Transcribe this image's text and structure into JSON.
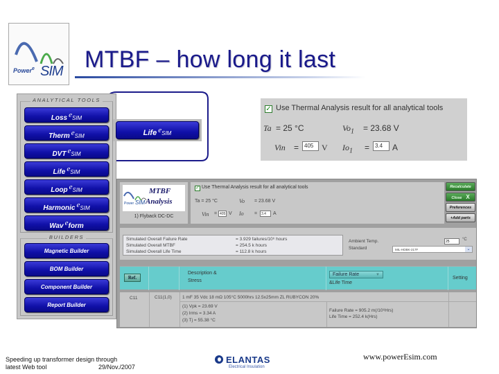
{
  "slide": {
    "title": "MTBF – how long it last",
    "logo": {
      "brand_prefix": "Power",
      "brand_e": "e",
      "brand_suffix": "SIM"
    }
  },
  "tool_panel": {
    "analytical_title": "ANALYTICAL TOOLS",
    "analytical_tools": [
      {
        "label": "Loss",
        "e": "e",
        "suffix": "SIM"
      },
      {
        "label": "Therm",
        "e": "e",
        "suffix": "SIM"
      },
      {
        "label": "DVT",
        "e": "e",
        "suffix": "SIM"
      },
      {
        "label": "Life",
        "e": "e",
        "suffix": "SIM"
      },
      {
        "label": "Loop",
        "e": "e",
        "suffix": "SIM"
      },
      {
        "label": "Harmonic",
        "e": "e",
        "suffix": "SIM"
      },
      {
        "label": "Wav",
        "e": "e",
        "suffix": "form"
      }
    ],
    "builders_title": "BUILDERS",
    "builders": [
      {
        "label": "Magnetic Builder"
      },
      {
        "label": "BOM Builder"
      },
      {
        "label": "Component Builder"
      },
      {
        "label": "Report Builder"
      }
    ]
  },
  "callout": {
    "label": "Life",
    "e": "e",
    "suffix": "SIM"
  },
  "thermal_zoom": {
    "checkbox_checked": true,
    "checkbox_label": "Use Thermal Analysis result for all analytical tools",
    "ta_label": "Ta",
    "ta_value": "= 25 °C",
    "vo_label": "Vo",
    "vo_sub": "1",
    "vo_value": "=   23.68 V",
    "vin_label": "Vin",
    "vin_eq": "=",
    "vin_value": "405",
    "vin_unit": "V",
    "io_label": "Io",
    "io_sub": "1",
    "io_eq": "=",
    "io_value": "3.4",
    "io_unit": "A"
  },
  "app": {
    "logo_title1": "MTBF",
    "logo_title2": "Analysis",
    "logo_power": "Power",
    "logo_sim": "SIM",
    "design_name": "1) Flyback DC-DC",
    "checkbox_label": "Use Thermal Analysis result for all analytical tools",
    "ta": "Ta = 25 °C",
    "vo_label": "Vo",
    "vo_value": "=   23.68 V",
    "vin_label": "Vin",
    "vin_eq": "=",
    "vin_value": "405",
    "vin_unit": "V",
    "io_label": "Io",
    "io_eq": "=",
    "io_value": "3.4",
    "io_unit": "A",
    "buttons": {
      "recalculate": "Recalculate",
      "close": "Close",
      "close_icon": "X",
      "preferences": "Preferences",
      "add_parts": "+Add parts"
    },
    "summary": [
      {
        "label": "Simulated Overall Failure Rate",
        "value": "= 3.929 failures/10⁶ hours"
      },
      {
        "label": "Simulated Overall MTBF",
        "value": "= 254.5 k hours"
      },
      {
        "label": "Simulated Overall Life Time",
        "value": "= 112.8 k hours"
      }
    ],
    "ambient_label": "Ambient Temp.",
    "ambient_value": "25",
    "ambient_unit": "°C",
    "standard_label": "Standard",
    "standard_value": "MIL-HDBK-217F",
    "table": {
      "ref_button": "Ref.",
      "desc_header": "Description & Stress",
      "desc_header_l1": "Description &",
      "desc_header_l2": "Stress",
      "failure_dropdown": "Failure Rate",
      "failure_header_l2": "&Life Time",
      "setting_header": "Setting",
      "rows": [
        {
          "ref": "C11",
          "id": "C11(1,0)",
          "description": "1 mF 35 Vdc 18 mΩ 105°C 5000hrs 12.5x25mm ZL RUBYCON 20%",
          "stress": [
            "(1) Vpk = 23.69 V",
            "(2) Irms = 3.34 A",
            "(3) Tj = 55.38 °C"
          ],
          "failure_rate": "Failure Rate = 905.2 m(/10⁶Hrs)",
          "life_time": "Life Time = 252.4 k(Hrs)"
        }
      ]
    }
  },
  "footer": {
    "caption_line1": "Speeding up transformer design through",
    "caption_line2": "latest Web tool",
    "date": "29/Nov./2007",
    "company": "ELANTAS",
    "company_sub": "Electrical Insulation",
    "url": "www.powerEsim.com"
  }
}
